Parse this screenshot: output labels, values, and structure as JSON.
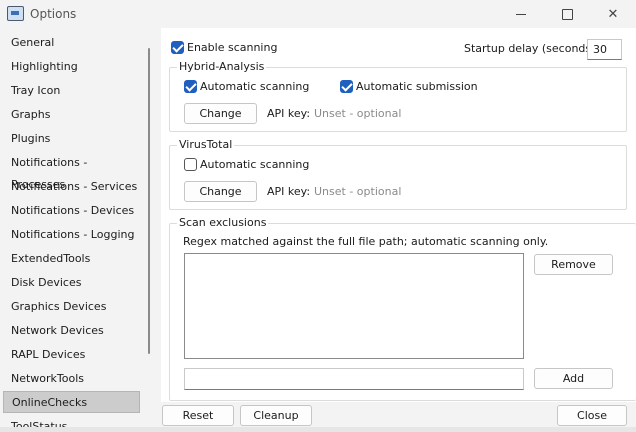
{
  "window": {
    "title": "Options"
  },
  "sidebar": {
    "items": [
      {
        "label": "General"
      },
      {
        "label": "Highlighting"
      },
      {
        "label": "Tray Icon"
      },
      {
        "label": "Graphs"
      },
      {
        "label": "Plugins"
      },
      {
        "label": "Notifications - Processes"
      },
      {
        "label": "Notifications - Services"
      },
      {
        "label": "Notifications - Devices"
      },
      {
        "label": "Notifications - Logging"
      },
      {
        "label": "ExtendedTools"
      },
      {
        "label": "Disk Devices"
      },
      {
        "label": "Graphics Devices"
      },
      {
        "label": "Network Devices"
      },
      {
        "label": "RAPL Devices"
      },
      {
        "label": "NetworkTools"
      },
      {
        "label": "OnlineChecks",
        "selected": true
      },
      {
        "label": "ToolStatus"
      }
    ]
  },
  "main": {
    "enable_scanning": {
      "label": "Enable scanning",
      "checked": true
    },
    "startup_delay": {
      "label": "Startup delay (seconds):",
      "value": "30"
    },
    "hybrid_analysis": {
      "title": "Hybrid-Analysis",
      "auto_scan": {
        "label": "Automatic scanning",
        "checked": true
      },
      "auto_submit": {
        "label": "Automatic submission",
        "checked": true
      },
      "change_label": "Change",
      "api_key_label": "API key:",
      "api_key_value": "Unset - optional"
    },
    "virustotal": {
      "title": "VirusTotal",
      "auto_scan": {
        "label": "Automatic scanning",
        "checked": false
      },
      "change_label": "Change",
      "api_key_label": "API key:",
      "api_key_value": "Unset - optional"
    },
    "exclusions": {
      "title": "Scan exclusions",
      "description": "Regex matched against the full file path; automatic scanning only.",
      "remove_label": "Remove",
      "add_label": "Add",
      "new_pattern_value": ""
    }
  },
  "footer": {
    "reset_label": "Reset",
    "cleanup_label": "Cleanup",
    "close_label": "Close"
  },
  "colors": {
    "accent": "#1f5fbf",
    "selected_bg": "#cccccc",
    "window_bg": "#f3f3f3"
  }
}
